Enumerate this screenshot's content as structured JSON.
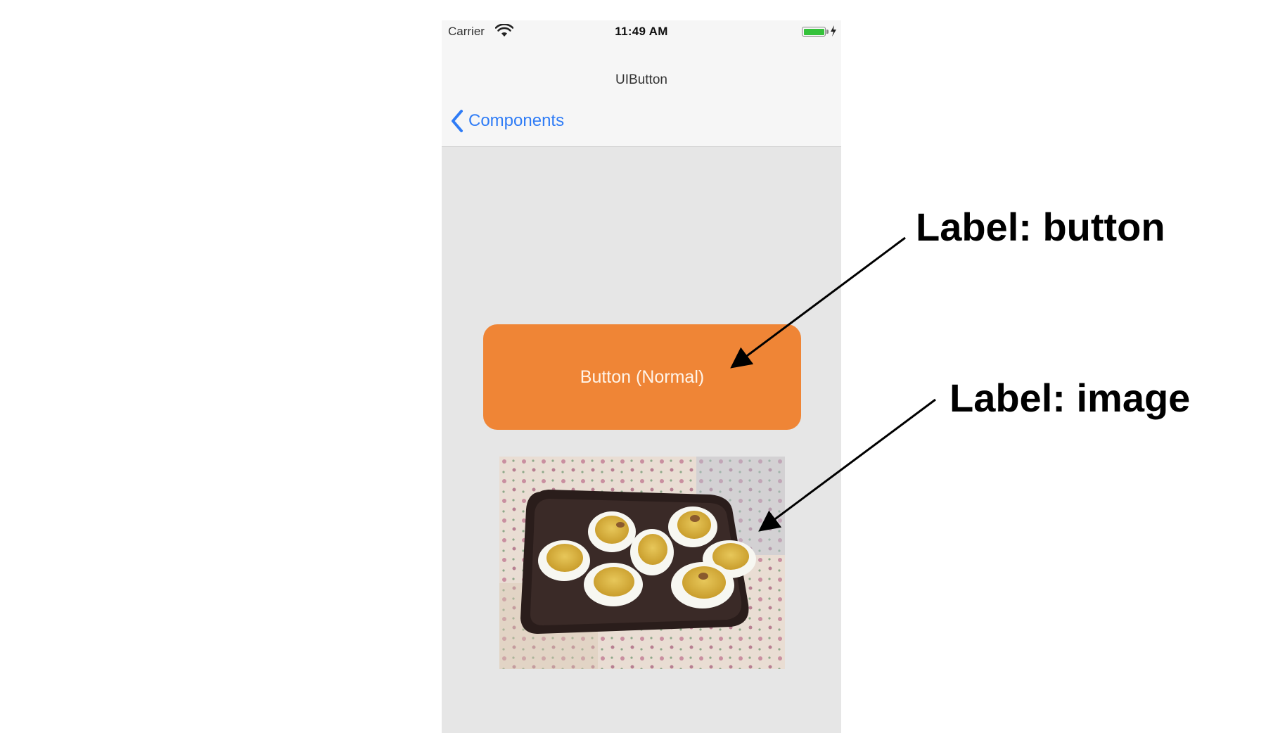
{
  "status_bar": {
    "carrier": "Carrier",
    "time": "11:49 AM",
    "wifi_icon": "wifi-icon",
    "battery_icon": "battery-charging-icon",
    "battery_color": "#35c23b"
  },
  "nav_bar": {
    "title": "UIButton",
    "back_label": "Components",
    "back_icon": "chevron-left-icon",
    "tint_color": "#2f7cf6"
  },
  "content": {
    "button_label": "Button (Normal)",
    "button_color": "#ef8536",
    "image_alt": "deviled eggs on a dark plate"
  },
  "annotations": {
    "button_label": "Label: button",
    "image_label": "Label: image"
  }
}
